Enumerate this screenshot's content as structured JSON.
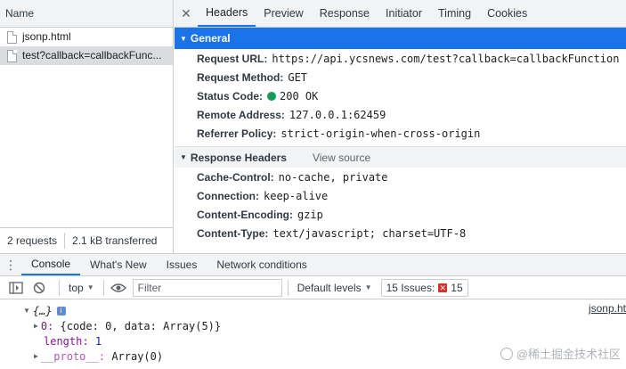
{
  "request_list": {
    "header": "Name",
    "items": [
      {
        "name": "jsonp.html"
      },
      {
        "name": "test?callback=callbackFunc..."
      }
    ],
    "footer": {
      "requests": "2 requests",
      "transferred": "2.1 kB transferred"
    }
  },
  "detail_tabs": [
    "Headers",
    "Preview",
    "Response",
    "Initiator",
    "Timing",
    "Cookies"
  ],
  "general": {
    "title": "General",
    "rows": [
      {
        "key": "Request URL:",
        "value": "https://api.ycsnews.com/test?callback=callbackFunction"
      },
      {
        "key": "Request Method:",
        "value": "GET"
      },
      {
        "key": "Status Code:",
        "value": "200 OK"
      },
      {
        "key": "Remote Address:",
        "value": "127.0.0.1:62459"
      },
      {
        "key": "Referrer Policy:",
        "value": "strict-origin-when-cross-origin"
      }
    ]
  },
  "response_headers": {
    "title": "Response Headers",
    "view_source": "View source",
    "rows": [
      {
        "key": "Cache-Control:",
        "value": "no-cache, private"
      },
      {
        "key": "Connection:",
        "value": "keep-alive"
      },
      {
        "key": "Content-Encoding:",
        "value": "gzip"
      },
      {
        "key": "Content-Type:",
        "value": "text/javascript; charset=UTF-8"
      }
    ]
  },
  "drawer_tabs": [
    "Console",
    "What's New",
    "Issues",
    "Network conditions"
  ],
  "console_toolbar": {
    "context": "top",
    "filter_placeholder": "Filter",
    "levels": "Default levels",
    "issues_label": "15 Issues:",
    "issues_count": "15"
  },
  "console_output": {
    "source": "jsonp.ht",
    "root": "{…}",
    "info": "i",
    "line0_key": "0:",
    "line0_value": "{code: 0, data: Array(5)}",
    "length_key": "length:",
    "length_value": "1",
    "proto_key": "__proto__:",
    "proto_value": "Array(0)"
  },
  "watermark": "@稀土掘金技术社区",
  "colors": {
    "accent": "#1a73e8",
    "status_ok": "#0f9d58",
    "issue_error": "#d93025"
  }
}
